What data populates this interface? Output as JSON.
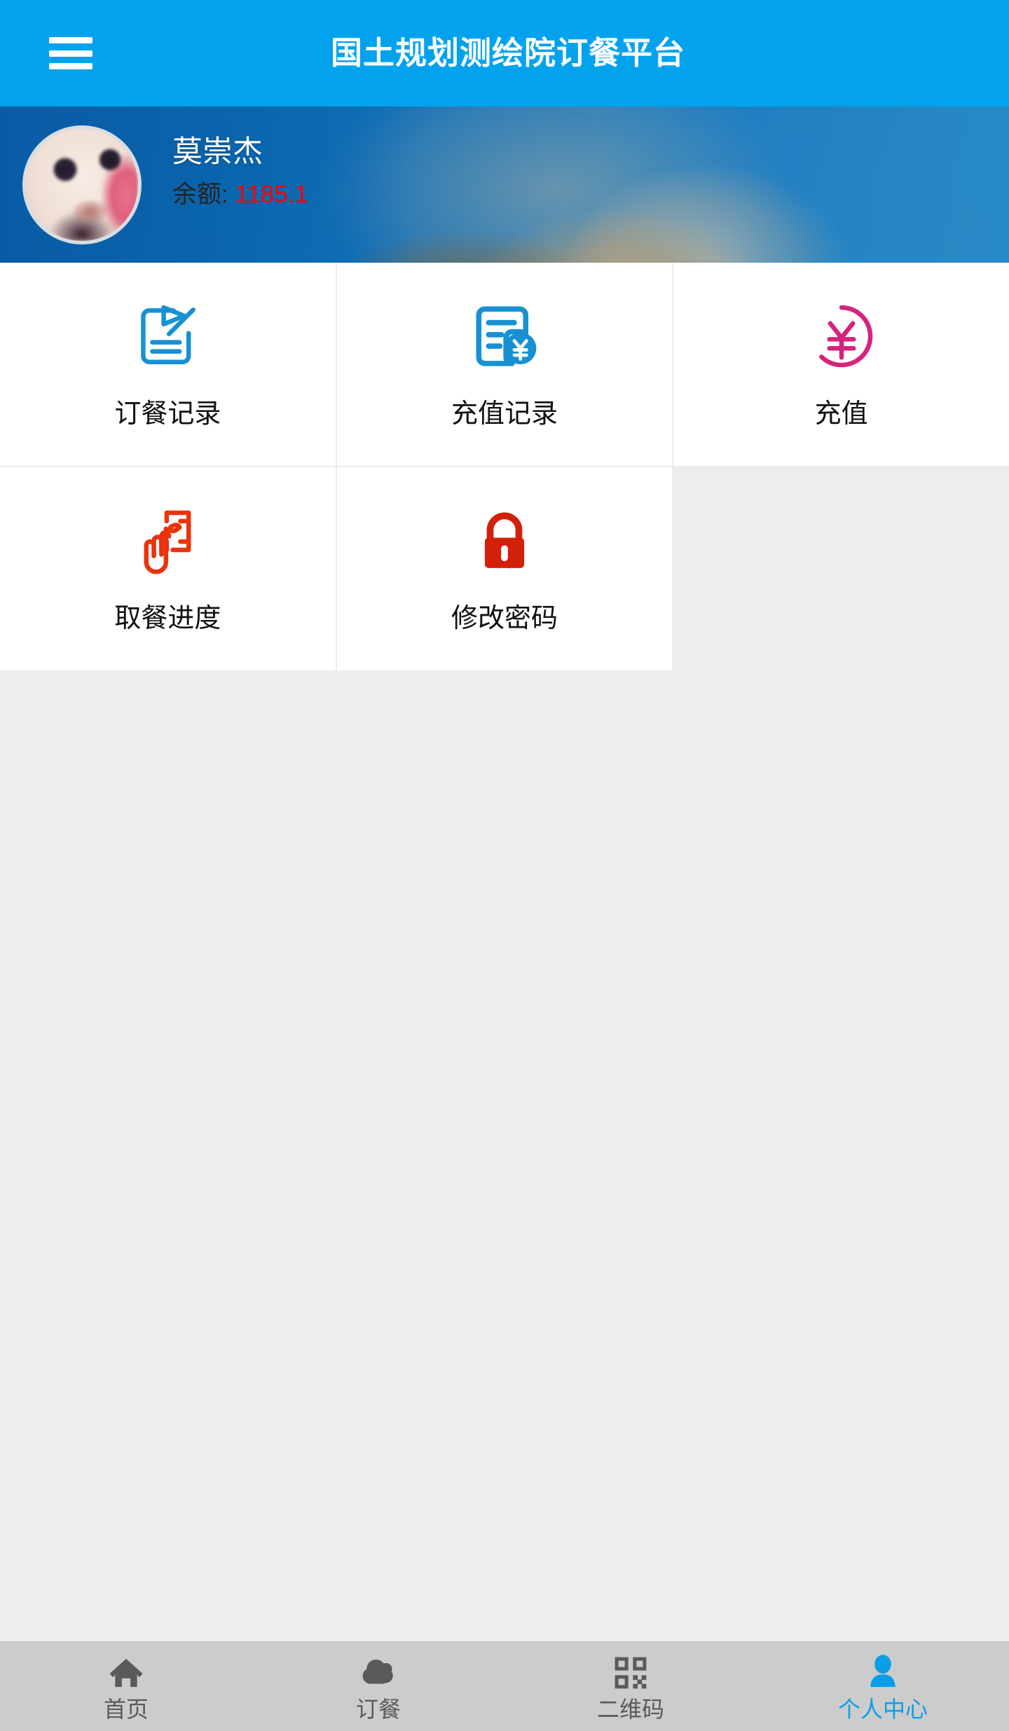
{
  "header": {
    "menu_icon": "hamburger-menu-icon",
    "title": "国土规划测绘院订餐平台",
    "background_color": "#02A3EC"
  },
  "profile": {
    "avatar_icon": "user-avatar-photo",
    "name": "莫崇杰",
    "balance_label": "余额:",
    "balance_value": "1185.1",
    "balance_color": "#ff0000"
  },
  "menu_grid": {
    "items": [
      {
        "label": "订餐记录",
        "icon": "document-edit-icon",
        "color": "#1791D3"
      },
      {
        "label": "充值记录",
        "icon": "document-yuan-icon",
        "color": "#1791D3"
      },
      {
        "label": "充值",
        "icon": "yuan-circle-icon",
        "color": "#D6237C"
      },
      {
        "label": "取餐进度",
        "icon": "hand-card-icon",
        "color": "#E8340C"
      },
      {
        "label": "修改密码",
        "icon": "lock-icon",
        "color": "#D3200A"
      }
    ]
  },
  "bottom_nav": {
    "items": [
      {
        "label": "首页",
        "icon": "home-icon",
        "active": false
      },
      {
        "label": "订餐",
        "icon": "cloud-icon",
        "active": false
      },
      {
        "label": "二维码",
        "icon": "qrcode-icon",
        "active": false
      },
      {
        "label": "个人中心",
        "icon": "person-icon",
        "active": true
      }
    ],
    "active_color": "#0A9EE8",
    "inactive_color": "#5A5A5A",
    "background_color": "#CCCCCC"
  }
}
